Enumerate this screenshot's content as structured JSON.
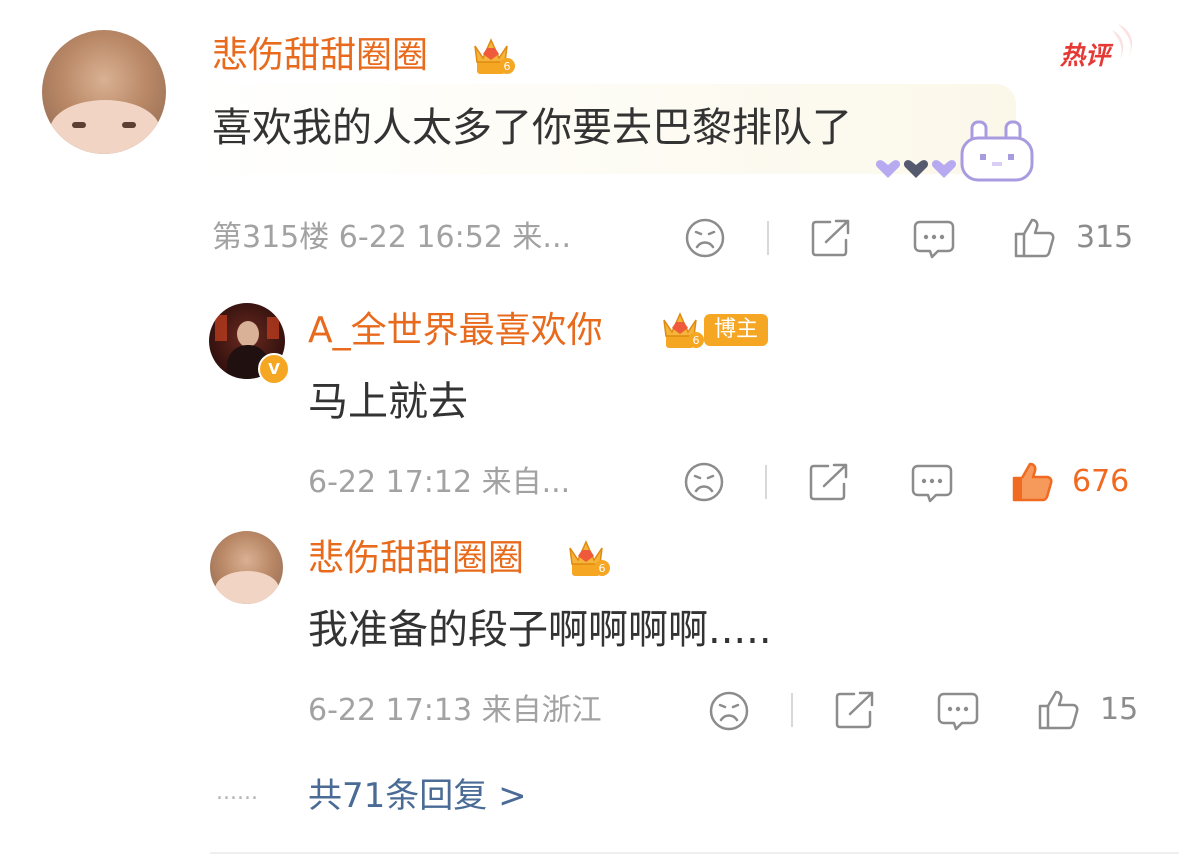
{
  "top_comment": {
    "username": "悲伤甜甜圈圈",
    "level_badge": "6",
    "hot_badge": "热评",
    "text": "喜欢我的人太多了你要去巴黎排队了",
    "meta": "第315楼 6-22 16:52 来...",
    "like_count": "315",
    "icons": [
      "sad-face-icon",
      "share-icon",
      "comment-icon",
      "thumbs-up-icon"
    ]
  },
  "replies": [
    {
      "username": "A_全世界最喜欢你",
      "level_badge": "6",
      "author_tag": "博主",
      "verified_badge": "V",
      "text": "马上就去",
      "meta": "6-22 17:12 来自...",
      "like_count": "676",
      "liked": true
    },
    {
      "username": "悲伤甜甜圈圈",
      "level_badge": "6",
      "text": "我准备的段子啊啊啊啊.....",
      "meta": "6-22 17:13 来自浙江",
      "like_count": "15",
      "liked": false
    }
  ],
  "more_replies": {
    "dots": "......",
    "label": "共71条回复 >"
  },
  "colors": {
    "accent": "#e86a1c",
    "text": "#333333",
    "meta": "#a2a2a2",
    "liked": "#f06a22",
    "link": "#4a6b95"
  }
}
